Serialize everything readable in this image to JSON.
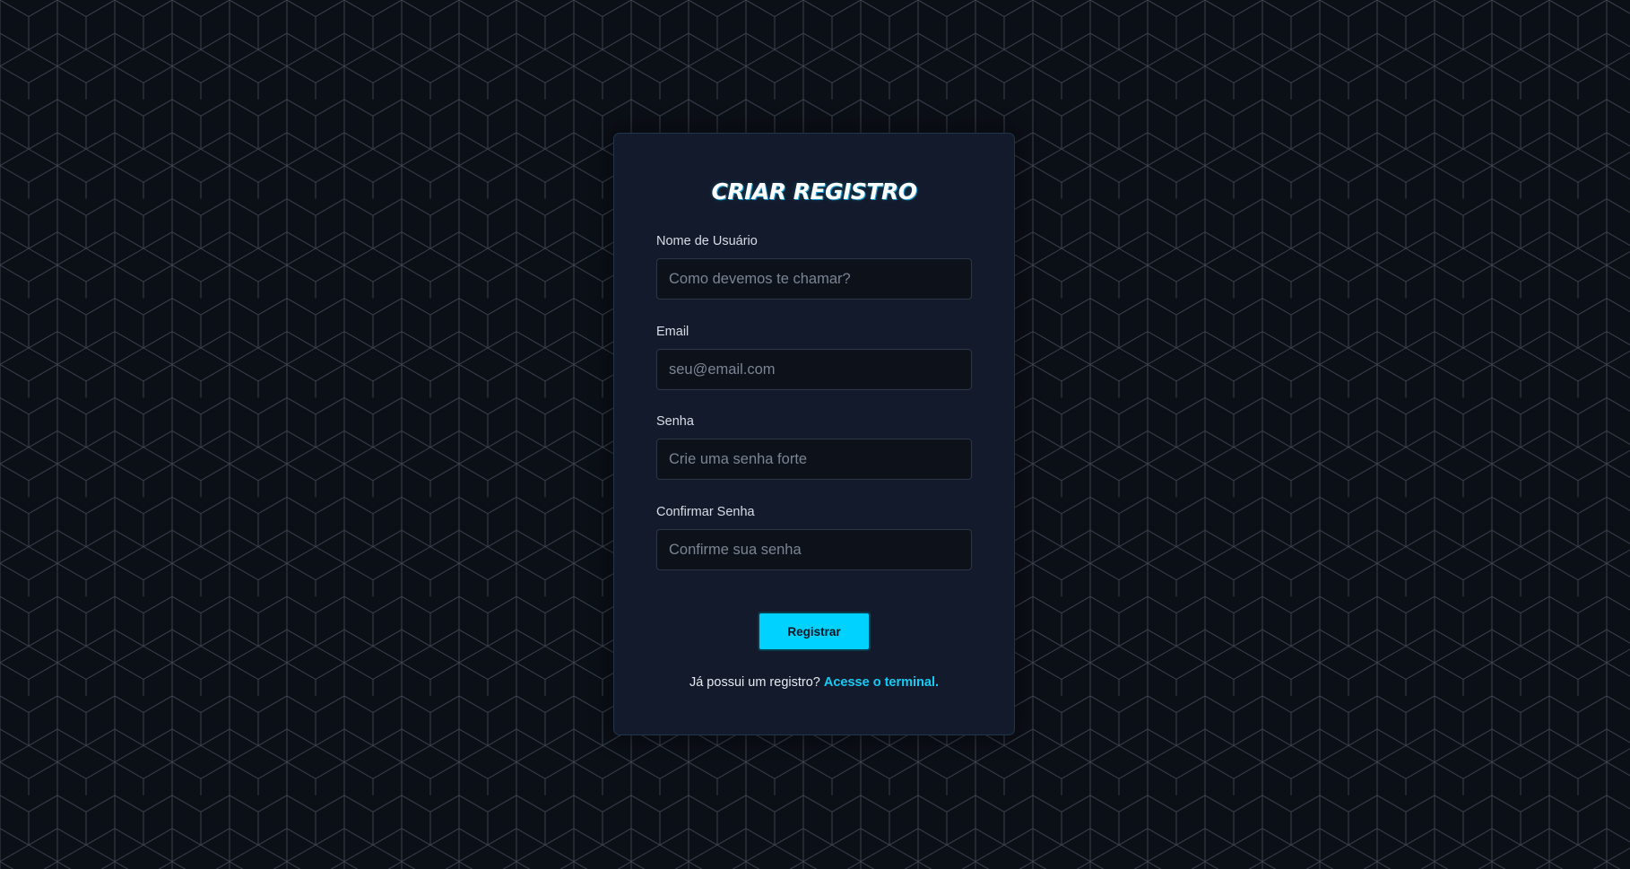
{
  "background": {
    "color": "#0b0f16",
    "pattern": "isometric-cubes",
    "line_color": "#3b4250"
  },
  "register": {
    "title": "CRIAR REGISTRO",
    "fields": [
      {
        "label": "Nome de Usuário",
        "placeholder": "Como devemos te chamar?",
        "value": ""
      },
      {
        "label": "Email",
        "placeholder": "seu@email.com",
        "value": ""
      },
      {
        "label": "Senha",
        "placeholder": "Crie uma senha forte",
        "value": ""
      },
      {
        "label": "Confirmar Senha",
        "placeholder": "Confirme sua senha",
        "value": ""
      }
    ],
    "submit_label": "Registrar",
    "footer_text": "Já possui um registro?",
    "login_link": "Acesse o terminal."
  },
  "colors": {
    "accent": "#00d2ff",
    "card": "#131a2b",
    "input_bg": "#0c111a"
  }
}
